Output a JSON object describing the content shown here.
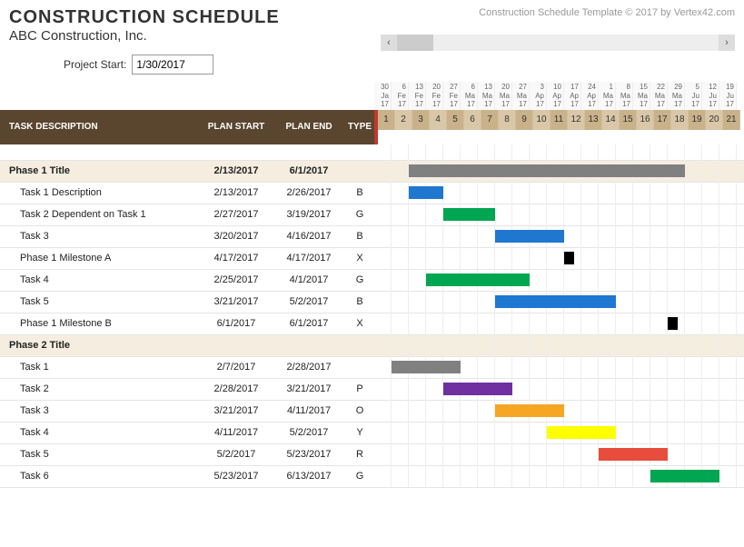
{
  "header": {
    "title": "CONSTRUCTION SCHEDULE",
    "subtitle": "ABC Construction, Inc.",
    "copyright": "Construction Schedule Template © 2017 by Vertex42.com",
    "project_start_label": "Project Start:",
    "project_start_value": "1/30/2017"
  },
  "columns": {
    "task": "TASK DESCRIPTION",
    "plan_start": "PLAN START",
    "plan_end": "PLAN END",
    "type": "TYPE"
  },
  "timeline": {
    "dates": [
      {
        "d": "30",
        "m": "Ja",
        "y": "17"
      },
      {
        "d": "6",
        "m": "Fe",
        "y": "17"
      },
      {
        "d": "13",
        "m": "Fe",
        "y": "17"
      },
      {
        "d": "20",
        "m": "Fe",
        "y": "17"
      },
      {
        "d": "27",
        "m": "Fe",
        "y": "17"
      },
      {
        "d": "6",
        "m": "Ma",
        "y": "17"
      },
      {
        "d": "13",
        "m": "Ma",
        "y": "17"
      },
      {
        "d": "20",
        "m": "Ma",
        "y": "17"
      },
      {
        "d": "27",
        "m": "Ma",
        "y": "17"
      },
      {
        "d": "3",
        "m": "Ap",
        "y": "17"
      },
      {
        "d": "10",
        "m": "Ap",
        "y": "17"
      },
      {
        "d": "17",
        "m": "Ap",
        "y": "17"
      },
      {
        "d": "24",
        "m": "Ap",
        "y": "17"
      },
      {
        "d": "1",
        "m": "Ma",
        "y": "17"
      },
      {
        "d": "8",
        "m": "Ma",
        "y": "17"
      },
      {
        "d": "15",
        "m": "Ma",
        "y": "17"
      },
      {
        "d": "22",
        "m": "Ma",
        "y": "17"
      },
      {
        "d": "29",
        "m": "Ma",
        "y": "17"
      },
      {
        "d": "5",
        "m": "Ju",
        "y": "17"
      },
      {
        "d": "12",
        "m": "Ju",
        "y": "17"
      },
      {
        "d": "19",
        "m": "Ju",
        "y": "17"
      }
    ],
    "weeks": [
      "1",
      "2",
      "3",
      "4",
      "5",
      "6",
      "7",
      "8",
      "9",
      "10",
      "11",
      "12",
      "13",
      "14",
      "15",
      "16",
      "17",
      "18",
      "19",
      "20",
      "21"
    ]
  },
  "tasks": [
    {
      "desc": "Phase 1 Title",
      "start": "2/13/2017",
      "end": "6/1/2017",
      "type": "",
      "phase": true,
      "bar": {
        "from": 3,
        "to": 18,
        "color": "gray"
      }
    },
    {
      "desc": "Task 1 Description",
      "start": "2/13/2017",
      "end": "2/26/2017",
      "type": "B",
      "phase": false,
      "bar": {
        "from": 3,
        "to": 4,
        "color": "blue"
      }
    },
    {
      "desc": "Task 2 Dependent on Task 1",
      "start": "2/27/2017",
      "end": "3/19/2017",
      "type": "G",
      "phase": false,
      "bar": {
        "from": 5,
        "to": 7,
        "color": "green"
      }
    },
    {
      "desc": "Task 3",
      "start": "3/20/2017",
      "end": "4/16/2017",
      "type": "B",
      "phase": false,
      "bar": {
        "from": 8,
        "to": 11,
        "color": "blue"
      }
    },
    {
      "desc": "Phase 1 Milestone A",
      "start": "4/17/2017",
      "end": "4/17/2017",
      "type": "X",
      "phase": false,
      "bar": {
        "from": 12,
        "to": 12,
        "color": "black",
        "narrow": true
      }
    },
    {
      "desc": "Task 4",
      "start": "2/25/2017",
      "end": "4/1/2017",
      "type": "G",
      "phase": false,
      "bar": {
        "from": 4,
        "to": 9,
        "color": "green"
      }
    },
    {
      "desc": "Task 5",
      "start": "3/21/2017",
      "end": "5/2/2017",
      "type": "B",
      "phase": false,
      "bar": {
        "from": 8,
        "to": 14,
        "color": "blue"
      }
    },
    {
      "desc": "Phase 1 Milestone B",
      "start": "6/1/2017",
      "end": "6/1/2017",
      "type": "X",
      "phase": false,
      "bar": {
        "from": 18,
        "to": 18,
        "color": "black",
        "narrow": true
      }
    },
    {
      "desc": "Phase 2 Title",
      "start": "",
      "end": "",
      "type": "",
      "phase": true,
      "bar": null
    },
    {
      "desc": "Task 1",
      "start": "2/7/2017",
      "end": "2/28/2017",
      "type": "",
      "phase": false,
      "bar": {
        "from": 2,
        "to": 5,
        "color": "gray"
      }
    },
    {
      "desc": "Task 2",
      "start": "2/28/2017",
      "end": "3/21/2017",
      "type": "P",
      "phase": false,
      "bar": {
        "from": 5,
        "to": 8,
        "color": "purple"
      }
    },
    {
      "desc": "Task 3",
      "start": "3/21/2017",
      "end": "4/11/2017",
      "type": "O",
      "phase": false,
      "bar": {
        "from": 8,
        "to": 11,
        "color": "orange"
      }
    },
    {
      "desc": "Task 4",
      "start": "4/11/2017",
      "end": "5/2/2017",
      "type": "Y",
      "phase": false,
      "bar": {
        "from": 11,
        "to": 14,
        "color": "yellow"
      }
    },
    {
      "desc": "Task 5",
      "start": "5/2/2017",
      "end": "5/23/2017",
      "type": "R",
      "phase": false,
      "bar": {
        "from": 14,
        "to": 17,
        "color": "red"
      }
    },
    {
      "desc": "Task 6",
      "start": "5/23/2017",
      "end": "6/13/2017",
      "type": "G",
      "phase": false,
      "bar": {
        "from": 17,
        "to": 20,
        "color": "green"
      }
    }
  ],
  "chart_data": {
    "type": "gantt",
    "title": "CONSTRUCTION SCHEDULE",
    "x_start": "1/30/2017",
    "x_unit": "week",
    "x_range": [
      1,
      21
    ],
    "series": [
      {
        "name": "Phase 1 Title",
        "start_week": 3,
        "end_week": 18,
        "color": "gray"
      },
      {
        "name": "Task 1 Description",
        "start_week": 3,
        "end_week": 4,
        "color": "blue"
      },
      {
        "name": "Task 2 Dependent on Task 1",
        "start_week": 5,
        "end_week": 7,
        "color": "green"
      },
      {
        "name": "Task 3",
        "start_week": 8,
        "end_week": 11,
        "color": "blue"
      },
      {
        "name": "Phase 1 Milestone A",
        "start_week": 12,
        "end_week": 12,
        "color": "black"
      },
      {
        "name": "Task 4",
        "start_week": 4,
        "end_week": 9,
        "color": "green"
      },
      {
        "name": "Task 5",
        "start_week": 8,
        "end_week": 14,
        "color": "blue"
      },
      {
        "name": "Phase 1 Milestone B",
        "start_week": 18,
        "end_week": 18,
        "color": "black"
      },
      {
        "name": "Task 1 (P2)",
        "start_week": 2,
        "end_week": 5,
        "color": "gray"
      },
      {
        "name": "Task 2 (P2)",
        "start_week": 5,
        "end_week": 8,
        "color": "purple"
      },
      {
        "name": "Task 3 (P2)",
        "start_week": 8,
        "end_week": 11,
        "color": "orange"
      },
      {
        "name": "Task 4 (P2)",
        "start_week": 11,
        "end_week": 14,
        "color": "yellow"
      },
      {
        "name": "Task 5 (P2)",
        "start_week": 14,
        "end_week": 17,
        "color": "red"
      },
      {
        "name": "Task 6 (P2)",
        "start_week": 17,
        "end_week": 20,
        "color": "green"
      }
    ]
  }
}
